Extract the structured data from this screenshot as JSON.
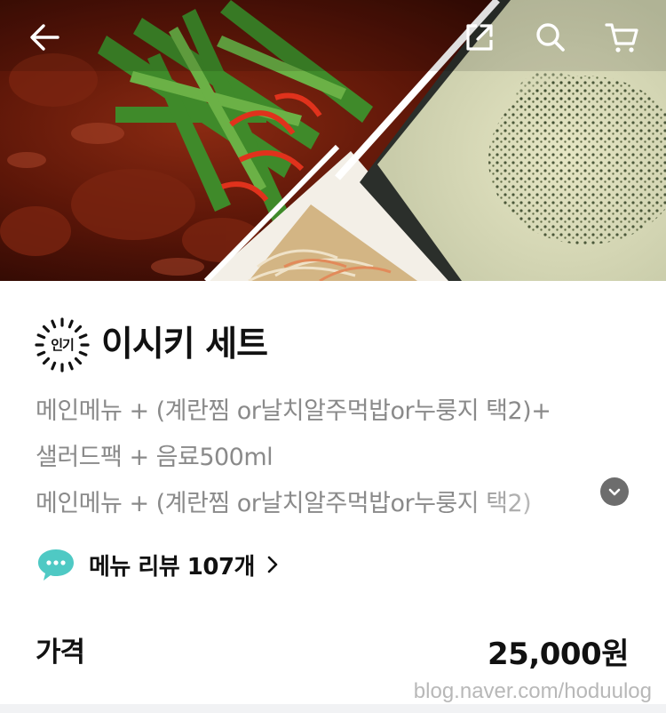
{
  "header": {
    "back_icon": "arrow-left-icon",
    "share_icon": "share-external-icon",
    "search_icon": "search-icon",
    "cart_icon": "cart-icon"
  },
  "menu": {
    "badge": "인기",
    "title": "이시키 세트",
    "description_lines": [
      "메인메뉴 + (계란찜 or날치알주먹밥or누룽지 택2)+",
      "샐러드팩  + 음료500ml",
      "메인메뉴 +  (계란찜 or날치알주먹밥or누룽지 택2)"
    ],
    "expand_icon": "chevron-down-icon"
  },
  "review": {
    "icon": "speech-bubble-icon",
    "label": "메뉴 리뷰 107개",
    "chevron_icon": "chevron-right-icon"
  },
  "price": {
    "label": "가격",
    "value": "25,000원"
  },
  "watermark": "blog.naver.com/hoduulog",
  "colors": {
    "text_primary": "#111111",
    "text_secondary": "#8a8a8a",
    "review_icon": "#4fc9c4",
    "expand_button": "#6d6d6d"
  }
}
